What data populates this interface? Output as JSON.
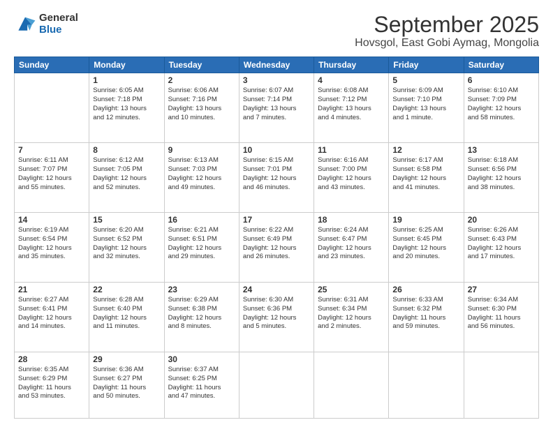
{
  "logo": {
    "general": "General",
    "blue": "Blue"
  },
  "header": {
    "title": "September 2025",
    "subtitle": "Hovsgol, East Gobi Aymag, Mongolia"
  },
  "weekdays": [
    "Sunday",
    "Monday",
    "Tuesday",
    "Wednesday",
    "Thursday",
    "Friday",
    "Saturday"
  ],
  "weeks": [
    [
      {
        "num": "",
        "info": ""
      },
      {
        "num": "1",
        "info": "Sunrise: 6:05 AM\nSunset: 7:18 PM\nDaylight: 13 hours\nand 12 minutes."
      },
      {
        "num": "2",
        "info": "Sunrise: 6:06 AM\nSunset: 7:16 PM\nDaylight: 13 hours\nand 10 minutes."
      },
      {
        "num": "3",
        "info": "Sunrise: 6:07 AM\nSunset: 7:14 PM\nDaylight: 13 hours\nand 7 minutes."
      },
      {
        "num": "4",
        "info": "Sunrise: 6:08 AM\nSunset: 7:12 PM\nDaylight: 13 hours\nand 4 minutes."
      },
      {
        "num": "5",
        "info": "Sunrise: 6:09 AM\nSunset: 7:10 PM\nDaylight: 13 hours\nand 1 minute."
      },
      {
        "num": "6",
        "info": "Sunrise: 6:10 AM\nSunset: 7:09 PM\nDaylight: 12 hours\nand 58 minutes."
      }
    ],
    [
      {
        "num": "7",
        "info": "Sunrise: 6:11 AM\nSunset: 7:07 PM\nDaylight: 12 hours\nand 55 minutes."
      },
      {
        "num": "8",
        "info": "Sunrise: 6:12 AM\nSunset: 7:05 PM\nDaylight: 12 hours\nand 52 minutes."
      },
      {
        "num": "9",
        "info": "Sunrise: 6:13 AM\nSunset: 7:03 PM\nDaylight: 12 hours\nand 49 minutes."
      },
      {
        "num": "10",
        "info": "Sunrise: 6:15 AM\nSunset: 7:01 PM\nDaylight: 12 hours\nand 46 minutes."
      },
      {
        "num": "11",
        "info": "Sunrise: 6:16 AM\nSunset: 7:00 PM\nDaylight: 12 hours\nand 43 minutes."
      },
      {
        "num": "12",
        "info": "Sunrise: 6:17 AM\nSunset: 6:58 PM\nDaylight: 12 hours\nand 41 minutes."
      },
      {
        "num": "13",
        "info": "Sunrise: 6:18 AM\nSunset: 6:56 PM\nDaylight: 12 hours\nand 38 minutes."
      }
    ],
    [
      {
        "num": "14",
        "info": "Sunrise: 6:19 AM\nSunset: 6:54 PM\nDaylight: 12 hours\nand 35 minutes."
      },
      {
        "num": "15",
        "info": "Sunrise: 6:20 AM\nSunset: 6:52 PM\nDaylight: 12 hours\nand 32 minutes."
      },
      {
        "num": "16",
        "info": "Sunrise: 6:21 AM\nSunset: 6:51 PM\nDaylight: 12 hours\nand 29 minutes."
      },
      {
        "num": "17",
        "info": "Sunrise: 6:22 AM\nSunset: 6:49 PM\nDaylight: 12 hours\nand 26 minutes."
      },
      {
        "num": "18",
        "info": "Sunrise: 6:24 AM\nSunset: 6:47 PM\nDaylight: 12 hours\nand 23 minutes."
      },
      {
        "num": "19",
        "info": "Sunrise: 6:25 AM\nSunset: 6:45 PM\nDaylight: 12 hours\nand 20 minutes."
      },
      {
        "num": "20",
        "info": "Sunrise: 6:26 AM\nSunset: 6:43 PM\nDaylight: 12 hours\nand 17 minutes."
      }
    ],
    [
      {
        "num": "21",
        "info": "Sunrise: 6:27 AM\nSunset: 6:41 PM\nDaylight: 12 hours\nand 14 minutes."
      },
      {
        "num": "22",
        "info": "Sunrise: 6:28 AM\nSunset: 6:40 PM\nDaylight: 12 hours\nand 11 minutes."
      },
      {
        "num": "23",
        "info": "Sunrise: 6:29 AM\nSunset: 6:38 PM\nDaylight: 12 hours\nand 8 minutes."
      },
      {
        "num": "24",
        "info": "Sunrise: 6:30 AM\nSunset: 6:36 PM\nDaylight: 12 hours\nand 5 minutes."
      },
      {
        "num": "25",
        "info": "Sunrise: 6:31 AM\nSunset: 6:34 PM\nDaylight: 12 hours\nand 2 minutes."
      },
      {
        "num": "26",
        "info": "Sunrise: 6:33 AM\nSunset: 6:32 PM\nDaylight: 11 hours\nand 59 minutes."
      },
      {
        "num": "27",
        "info": "Sunrise: 6:34 AM\nSunset: 6:30 PM\nDaylight: 11 hours\nand 56 minutes."
      }
    ],
    [
      {
        "num": "28",
        "info": "Sunrise: 6:35 AM\nSunset: 6:29 PM\nDaylight: 11 hours\nand 53 minutes."
      },
      {
        "num": "29",
        "info": "Sunrise: 6:36 AM\nSunset: 6:27 PM\nDaylight: 11 hours\nand 50 minutes."
      },
      {
        "num": "30",
        "info": "Sunrise: 6:37 AM\nSunset: 6:25 PM\nDaylight: 11 hours\nand 47 minutes."
      },
      {
        "num": "",
        "info": ""
      },
      {
        "num": "",
        "info": ""
      },
      {
        "num": "",
        "info": ""
      },
      {
        "num": "",
        "info": ""
      }
    ]
  ]
}
